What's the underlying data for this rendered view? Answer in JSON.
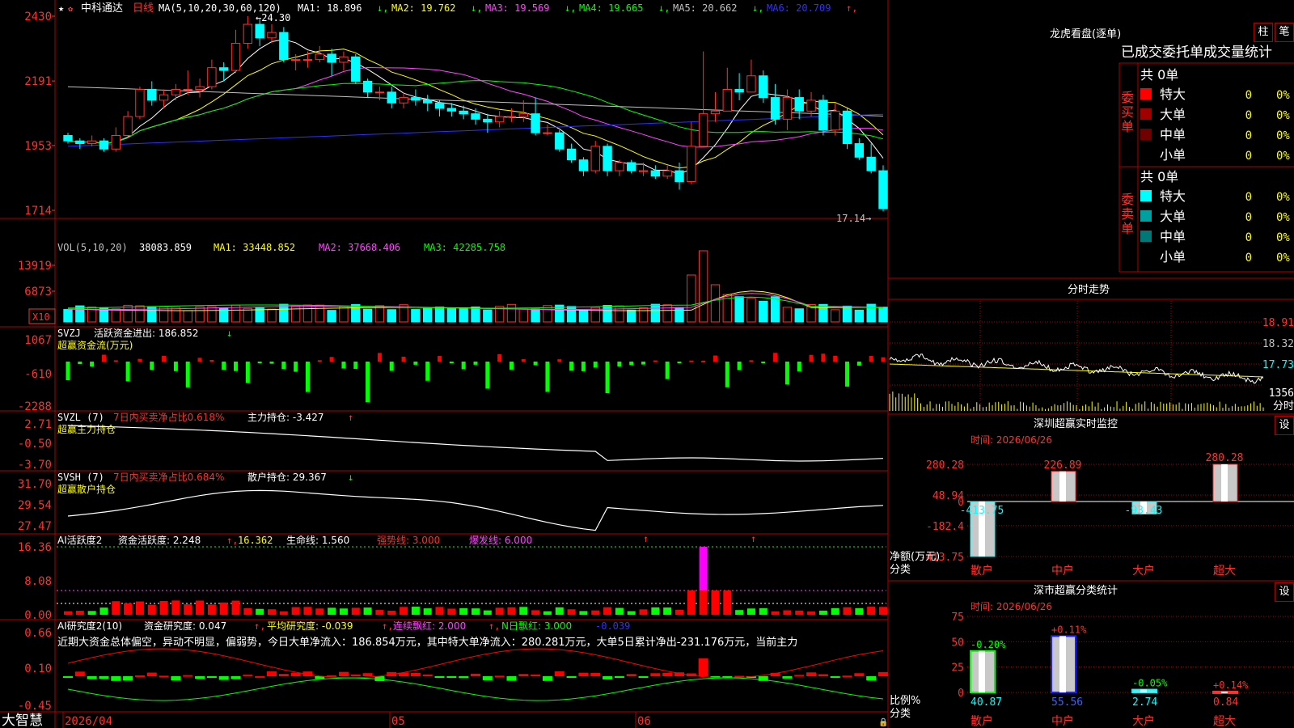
{
  "app": {
    "brand": "大智慧"
  },
  "main": {
    "stock_name": "中科通达",
    "period": "日线",
    "ma_header": "MA(5,10,20,30,60,120)",
    "ma_values": [
      {
        "label": "MA1: 18.896",
        "arrow": "↓",
        "color": "#ffffff"
      },
      {
        "label": "MA2: 19.762",
        "arrow": "↓",
        "color": "#ffff00"
      },
      {
        "label": "MA3: 19.569",
        "arrow": "↓",
        "color": "#ff44ff"
      },
      {
        "label": "MA4: 19.665",
        "arrow": "↓",
        "color": "#00ff00"
      },
      {
        "label": "MA5: 20.662",
        "arrow": "↓",
        "color": "#c0c0c0"
      },
      {
        "label": "MA6: 20.709",
        "arrow": "↑",
        "color": "#3030ff"
      }
    ],
    "yticks": [
      "2430",
      "2191",
      "1953",
      "1714"
    ],
    "high_label": "24.30",
    "low_label": "17.14"
  },
  "vol": {
    "header": "VOL(5,10,20)",
    "value": "38083.859",
    "ma1": "MA1: 33448.852",
    "ma2": "MA2: 37668.406",
    "ma3": "MA3: 42285.758",
    "yticks": [
      "13919",
      "6873"
    ],
    "unit": "X10"
  },
  "svzj": {
    "header": "SVZJ",
    "line1": "活跃资金进出: 186.852",
    "line1_arrow": "↓",
    "line2": "超赢资金流(万元)",
    "yticks": [
      "1067",
      "-610",
      "-2288"
    ]
  },
  "svzl": {
    "header": "SVZL (7)",
    "pct": "7日内买卖净占比0.618%",
    "hold": "主力持仓: -3.427",
    "hold_arrow": "↑",
    "line2": "超赢主力持仓",
    "yticks": [
      "2.71",
      "-0.50",
      "-3.70"
    ]
  },
  "svsh": {
    "header": "SVSH (7)",
    "pct": "7日内买卖净占比0.684%",
    "hold": "散户持仓: 29.367",
    "hold_arrow": "↓",
    "line2": "超赢散户持仓",
    "yticks": [
      "31.70",
      "29.54",
      "27.47"
    ]
  },
  "ai1": {
    "header": "AI活跃度2",
    "v1": "资金活跃度: 2.248",
    "v2": "16.362",
    "v3": "生命线: 1.560",
    "v4": "强势线: 3.000",
    "v5": "爆发线: 6.000",
    "yticks": [
      "16.36",
      "8.08",
      "0.00"
    ]
  },
  "ai2": {
    "header": "AI研究度2(10)",
    "v1": "资金研究度: 0.047",
    "v2": "平均研究度: -0.039",
    "v3": "连续飘红: 2.000",
    "v4": "N日飘红: 3.000",
    "v5": "-0.039",
    "comment": "近期大资金总体偏空，异动不明显，偏弱势，今日大单净流入：186.854万元，其中特大单净流入：280.281万元，大单5日累计净出-231.176万元，当前主力",
    "yticks": [
      "0.66",
      "0.10",
      "-0.45"
    ]
  },
  "xaxis": {
    "labels": [
      "2026/04",
      "05",
      "06"
    ]
  },
  "dragon": {
    "title": "龙虎看盘(逐单)",
    "btn_zhu": "柱",
    "btn_bi": "笔",
    "subtitle": "已成交委托单成交量统计",
    "buy_label": "委买单",
    "sell_label": "委卖单",
    "buy_total": "共 0单",
    "sell_total": "共 0单",
    "buy_rows": [
      {
        "label": "特大",
        "count": "0",
        "pct": "0%",
        "color": "#ff0000"
      },
      {
        "label": "大单",
        "count": "0",
        "pct": "0%",
        "color": "#a00000"
      },
      {
        "label": "中单",
        "count": "0",
        "pct": "0%",
        "color": "#700000"
      },
      {
        "label": "小单",
        "count": "0",
        "pct": "0%",
        "color": ""
      }
    ],
    "sell_rows": [
      {
        "label": "特大",
        "count": "0",
        "pct": "0%",
        "color": "#00ffff"
      },
      {
        "label": "大单",
        "count": "0",
        "pct": "0%",
        "color": "#00a0a0"
      },
      {
        "label": "中单",
        "count": "0",
        "pct": "0%",
        "color": "#007878"
      },
      {
        "label": "小单",
        "count": "0",
        "pct": "0%",
        "color": ""
      }
    ]
  },
  "intraday": {
    "title": "分时走势",
    "yticks": [
      "18.91",
      "18.32",
      "17.73"
    ],
    "vol_tick": "1356",
    "unit": "分时"
  },
  "monitor": {
    "title": "深圳超赢实时监控",
    "setting": "设",
    "time": "时间: 2026/06/26",
    "side_label": "净额(万元)",
    "side_label2": "分类",
    "yticks": [
      "280.28",
      "48.94",
      "0",
      "-182.4",
      "-413.75"
    ],
    "categories": [
      "散户",
      "中户",
      "大户",
      "超大"
    ],
    "values": [
      -413.75,
      226.89,
      -93.43,
      280.28
    ],
    "value_labels": [
      "-413.75",
      "226.89",
      "-93.43",
      "280.28"
    ]
  },
  "classify": {
    "title": "深市超赢分类统计",
    "setting": "设",
    "time": "时间: 2026/06/26",
    "side_label": "比例%",
    "side_label2": "分类",
    "yticks": [
      "75",
      "50",
      "25",
      "0"
    ],
    "categories": [
      "散户",
      "中户",
      "大户",
      "超大"
    ],
    "values": [
      40.87,
      55.56,
      2.74,
      0.84
    ],
    "value_labels": [
      "40.87",
      "55.56",
      "2.74",
      "0.84"
    ],
    "changes": [
      "-0.20%",
      "+0.11%",
      "-0.05%",
      "+0.14%"
    ]
  },
  "chart_data": {
    "type": "candlestick",
    "title": "中科通达 日线",
    "x": [
      "2026/04",
      "",
      "",
      "",
      "",
      "",
      "",
      "",
      "",
      "",
      "",
      "",
      "",
      "",
      "",
      "",
      "",
      "",
      "",
      "",
      "",
      "",
      "",
      "",
      "",
      "05",
      "",
      "",
      "",
      "",
      "",
      "",
      "",
      "",
      "",
      "",
      "",
      "",
      "",
      "",
      "",
      "",
      "",
      "",
      "",
      "06",
      "",
      "",
      "",
      "",
      "",
      "",
      "",
      "",
      "",
      "",
      "",
      "",
      "",
      "",
      "",
      "",
      "",
      "",
      ""
    ],
    "ohlc": [
      [
        19.9,
        19.7,
        20.0,
        19.6
      ],
      [
        19.7,
        19.6,
        19.8,
        19.4
      ],
      [
        19.6,
        19.7,
        19.9,
        19.5
      ],
      [
        19.7,
        19.4,
        19.8,
        19.3
      ],
      [
        19.4,
        19.9,
        20.2,
        19.3
      ],
      [
        19.9,
        20.6,
        20.8,
        19.8
      ],
      [
        20.6,
        21.6,
        21.7,
        20.5
      ],
      [
        21.6,
        21.2,
        21.9,
        21.0
      ],
      [
        21.2,
        21.4,
        21.6,
        20.9
      ],
      [
        21.4,
        21.6,
        21.8,
        21.2
      ],
      [
        21.6,
        21.6,
        22.3,
        21.4
      ],
      [
        21.6,
        21.7,
        22.0,
        21.3
      ],
      [
        21.7,
        22.4,
        22.7,
        21.6
      ],
      [
        22.4,
        22.3,
        22.6,
        21.9
      ],
      [
        22.3,
        23.3,
        23.8,
        22.2
      ],
      [
        23.3,
        24.0,
        24.3,
        23.1
      ],
      [
        24.0,
        23.5,
        24.2,
        23.2
      ],
      [
        23.5,
        23.7,
        24.0,
        23.3
      ],
      [
        23.7,
        22.7,
        23.9,
        22.6
      ],
      [
        22.7,
        22.7,
        22.9,
        22.3
      ],
      [
        22.7,
        22.7,
        23.0,
        22.4
      ],
      [
        22.7,
        22.9,
        23.2,
        22.6
      ],
      [
        22.9,
        22.6,
        23.1,
        22.1
      ],
      [
        22.6,
        22.8,
        23.0,
        22.3
      ],
      [
        22.8,
        21.9,
        22.9,
        21.8
      ],
      [
        21.9,
        21.5,
        22.0,
        21.3
      ],
      [
        21.5,
        21.5,
        21.7,
        21.2
      ],
      [
        21.5,
        21.1,
        21.7,
        20.9
      ],
      [
        21.1,
        21.3,
        21.5,
        20.9
      ],
      [
        21.3,
        21.2,
        21.6,
        21.0
      ],
      [
        21.2,
        21.1,
        21.4,
        20.8
      ],
      [
        21.1,
        20.9,
        21.2,
        20.6
      ],
      [
        20.9,
        20.8,
        21.1,
        20.6
      ],
      [
        20.8,
        20.7,
        21.0,
        20.5
      ],
      [
        20.7,
        20.5,
        20.9,
        20.3
      ],
      [
        20.5,
        20.4,
        20.7,
        20.0
      ],
      [
        20.4,
        20.6,
        20.8,
        20.2
      ],
      [
        20.6,
        20.6,
        20.9,
        20.4
      ],
      [
        20.6,
        20.7,
        21.2,
        20.4
      ],
      [
        20.7,
        20.0,
        21.3,
        19.9
      ],
      [
        20.0,
        20.0,
        20.3,
        19.9
      ],
      [
        20.0,
        19.4,
        20.1,
        19.3
      ],
      [
        19.4,
        19.0,
        19.6,
        18.9
      ],
      [
        19.0,
        18.6,
        19.1,
        18.4
      ],
      [
        18.6,
        19.5,
        19.7,
        18.5
      ],
      [
        19.5,
        18.6,
        19.6,
        18.4
      ],
      [
        18.6,
        18.9,
        19.0,
        18.4
      ],
      [
        18.9,
        18.6,
        19.0,
        18.5
      ],
      [
        18.6,
        18.6,
        18.9,
        18.4
      ],
      [
        18.6,
        18.4,
        18.8,
        18.3
      ],
      [
        18.4,
        18.6,
        18.8,
        18.3
      ],
      [
        18.6,
        18.2,
        18.9,
        17.9
      ],
      [
        18.2,
        19.5,
        20.4,
        18.1
      ],
      [
        19.5,
        20.7,
        23.0,
        20.5
      ],
      [
        20.7,
        20.8,
        21.5,
        20.4
      ],
      [
        20.8,
        21.6,
        22.4,
        20.8
      ],
      [
        21.6,
        21.5,
        22.2,
        21.2
      ],
      [
        21.5,
        22.1,
        22.7,
        21.5
      ],
      [
        22.1,
        21.3,
        22.3,
        21.1
      ],
      [
        21.3,
        20.5,
        21.8,
        20.3
      ],
      [
        20.5,
        21.3,
        21.6,
        20.1
      ],
      [
        21.3,
        20.8,
        21.6,
        20.5
      ],
      [
        20.8,
        21.2,
        21.5,
        20.6
      ],
      [
        21.2,
        20.1,
        21.4,
        19.9
      ],
      [
        20.1,
        20.8,
        21.1,
        19.9
      ],
      [
        20.8,
        19.6,
        20.9,
        19.4
      ],
      [
        19.6,
        19.1,
        19.8,
        19.0
      ],
      [
        19.1,
        18.6,
        19.6,
        18.5
      ],
      [
        18.6,
        17.2,
        18.8,
        17.1
      ]
    ],
    "ylim": [
      17.14,
      24.3
    ]
  }
}
